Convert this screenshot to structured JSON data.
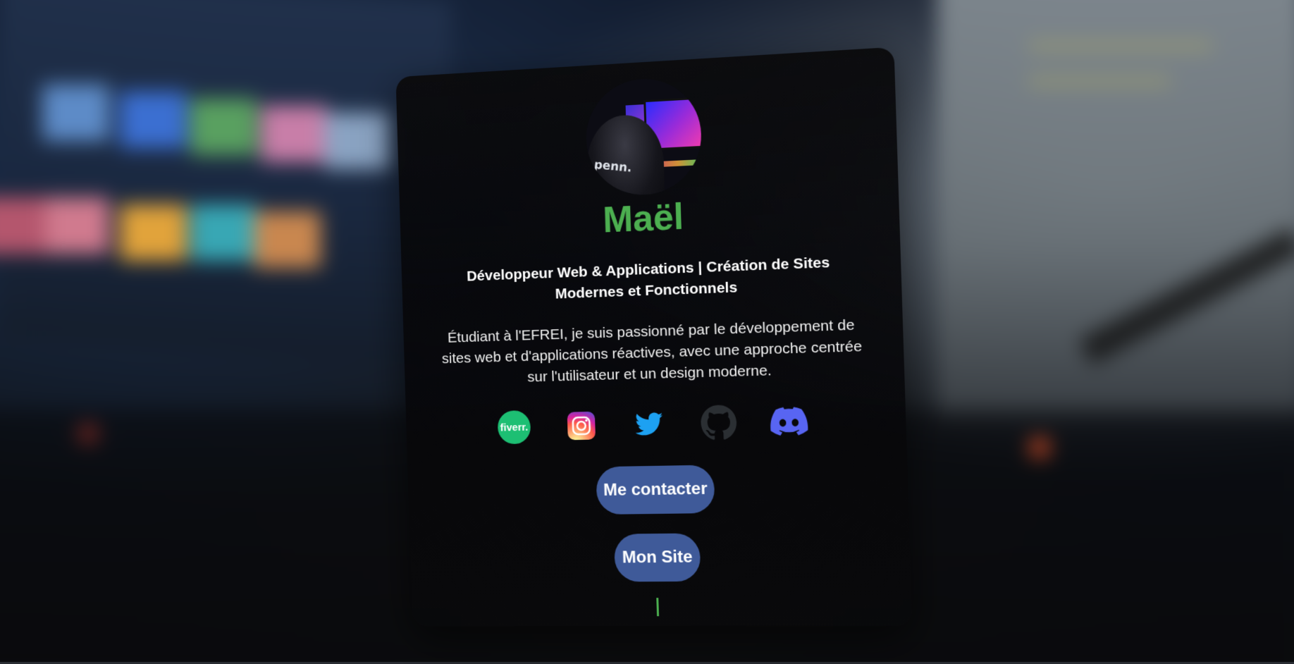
{
  "profile": {
    "name": "Maël",
    "headline": "Développeur Web & Applications | Création de Sites Modernes et Fonctionnels",
    "description": "Étudiant à l'EFREI, je suis passionné par le développement de sites web et d'applications réactives, avec une approche centrée sur l'utilisateur et un design moderne.",
    "avatar_shirt_text": "penn."
  },
  "socials": [
    {
      "name": "fiverr",
      "label": "fiverr.",
      "color": "#1dbf73"
    },
    {
      "name": "instagram",
      "color": "#d6249f"
    },
    {
      "name": "twitter",
      "color": "#1da1f2"
    },
    {
      "name": "github",
      "color": "#333333"
    },
    {
      "name": "discord",
      "color": "#5865f2"
    }
  ],
  "buttons": {
    "contact_label": "Me contacter",
    "site_label": "Mon Site"
  },
  "colors": {
    "accent": "#4caf50",
    "button": "#3f5a99",
    "card_bg": "#0a0a0c"
  }
}
